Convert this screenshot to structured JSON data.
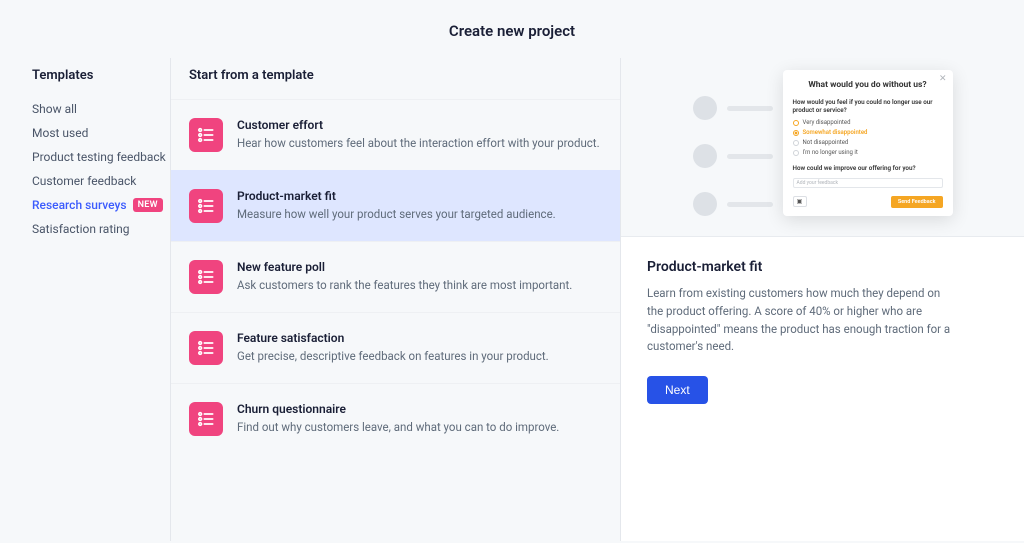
{
  "page_title": "Create new project",
  "sidebar": {
    "heading": "Templates",
    "items": [
      {
        "label": "Show all",
        "active": false
      },
      {
        "label": "Most used",
        "active": false
      },
      {
        "label": "Product testing feedback",
        "active": false
      },
      {
        "label": "Customer feedback",
        "active": false
      },
      {
        "label": "Research surveys",
        "active": true,
        "badge": "NEW"
      },
      {
        "label": "Satisfaction rating",
        "active": false
      }
    ]
  },
  "templates": {
    "heading": "Start from a template",
    "items": [
      {
        "title": "Customer effort",
        "desc": "Hear how customers feel about the interaction effort with your product.",
        "selected": false
      },
      {
        "title": "Product-market fit",
        "desc": "Measure how well your product serves your targeted audience.",
        "selected": true
      },
      {
        "title": "New feature poll",
        "desc": "Ask customers to rank the features they think are most important.",
        "selected": false
      },
      {
        "title": "Feature satisfaction",
        "desc": "Get precise, descriptive feedback on features in your product.",
        "selected": false
      },
      {
        "title": "Churn questionnaire",
        "desc": "Find out why customers leave, and what you can to do improve.",
        "selected": false
      }
    ]
  },
  "preview": {
    "survey_title": "What would you do without us?",
    "question1": "How would you feel if you could no longer use our product or service?",
    "options": [
      {
        "label": "Very disappointed",
        "selected": false
      },
      {
        "label": "Somewhat disappointed",
        "selected": true
      },
      {
        "label": "Not disappointed",
        "selected": false
      },
      {
        "label": "I'm no longer using it",
        "selected": false
      }
    ],
    "question2": "How could we improve our offering for you?",
    "input_placeholder": "Add your feedback",
    "send_label": "Send Feedback"
  },
  "detail": {
    "title": "Product-market fit",
    "desc": "Learn from existing customers how much they depend on the product offering. A score of 40% or higher who are \"disappointed\" means the product has enough traction for a customer's need.",
    "next_label": "Next"
  }
}
